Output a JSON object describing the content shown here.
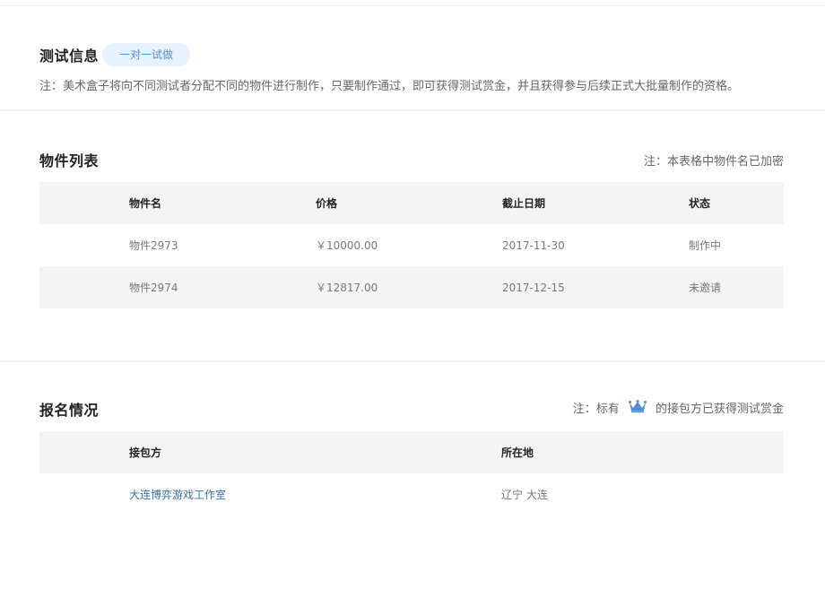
{
  "test_info": {
    "title": "测试信息",
    "badge": "一对一试做",
    "note": "注：美术盒子将向不同测试者分配不同的物件进行制作，只要制作通过，即可获得测试赏金，并且获得参与后续正式大批量制作的资格。"
  },
  "items": {
    "title": "物件列表",
    "note": "注：本表格中物件名已加密",
    "columns": [
      "物件名",
      "价格",
      "截止日期",
      "状态"
    ],
    "rows": [
      [
        "物件2973",
        "￥10000.00",
        "2017-11-30",
        "制作中"
      ],
      [
        "物件2974",
        "￥12817.00",
        "2017-12-15",
        "未邀请"
      ]
    ]
  },
  "registration": {
    "title": "报名情况",
    "note_prefix": "注：标有",
    "note_suffix": "的接包方已获得测试赏金",
    "crown_icon": "crown-icon",
    "crown_color": "#4a90d9",
    "columns": [
      "接包方",
      "所在地"
    ],
    "rows": [
      [
        "大连博弈游戏工作室",
        "辽宁 大连"
      ]
    ]
  }
}
